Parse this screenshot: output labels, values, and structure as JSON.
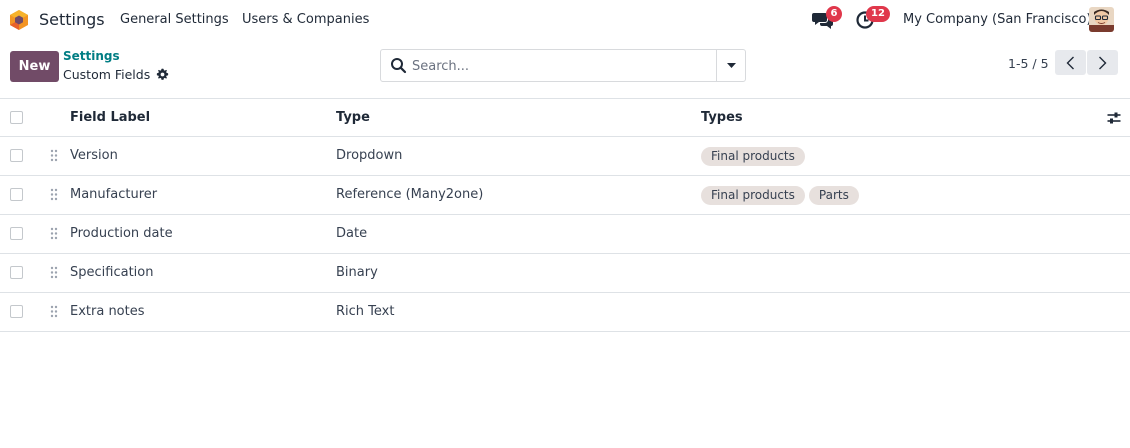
{
  "navbar": {
    "app_title": "Settings",
    "menu": [
      "General Settings",
      "Users & Companies"
    ],
    "chat_count": "6",
    "activity_count": "12",
    "company": "My Company (San Francisco)"
  },
  "control_panel": {
    "new_label": "New",
    "breadcrumb_parent": "Settings",
    "breadcrumb_current": "Custom Fields",
    "search_placeholder": "Search...",
    "pager": "1-5 / 5"
  },
  "table": {
    "columns": [
      "Field Label",
      "Type",
      "Types"
    ],
    "rows": [
      {
        "label": "Version",
        "type": "Dropdown",
        "types": [
          "Final products"
        ]
      },
      {
        "label": "Manufacturer",
        "type": "Reference (Many2one)",
        "types": [
          "Final products",
          "Parts"
        ]
      },
      {
        "label": "Production date",
        "type": "Date",
        "types": []
      },
      {
        "label": "Specification",
        "type": "Binary",
        "types": []
      },
      {
        "label": "Extra notes",
        "type": "Rich Text",
        "types": []
      }
    ]
  },
  "colors": {
    "brand": "#714b67",
    "link": "#017e84",
    "badge": "#e0374b",
    "tag_bg": "#e7e0dd"
  },
  "icons": [
    "app-logo-icon",
    "chat-icon",
    "activity-clock-icon",
    "gear-icon",
    "search-icon",
    "caret-down-icon",
    "chevron-left-icon",
    "chevron-right-icon",
    "drag-handle-icon",
    "column-settings-icon"
  ]
}
